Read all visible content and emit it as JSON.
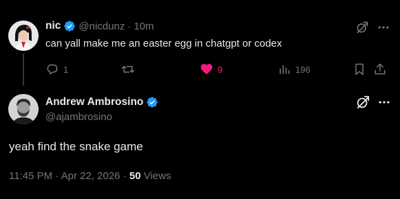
{
  "tweet1": {
    "display_name": "nic",
    "handle": "@nicdunz",
    "separator": "·",
    "time": "10m",
    "text": "can yall make me an easter egg in chatgpt or codex",
    "replies": "1",
    "likes": "9",
    "views": "196",
    "liked": true
  },
  "tweet2": {
    "display_name": "Andrew Ambrosino",
    "handle": "@ajambrosino",
    "text": "yeah find the snake game",
    "time": "11:45 PM",
    "separator": "·",
    "date": "Apr 22, 2026",
    "view_count": "50",
    "views_label": "Views"
  },
  "colors": {
    "background": "#000000",
    "text_primary": "#e7e9ea",
    "text_muted": "#71767b",
    "verified_blue": "#1d9bf0",
    "like_pink": "#f91880",
    "divider": "#333639"
  },
  "icons": [
    "verified-badge-icon",
    "grok-icon",
    "more-icon",
    "reply-icon",
    "retweet-icon",
    "like-heart-icon",
    "views-bar-chart-icon",
    "bookmark-icon",
    "share-icon"
  ]
}
